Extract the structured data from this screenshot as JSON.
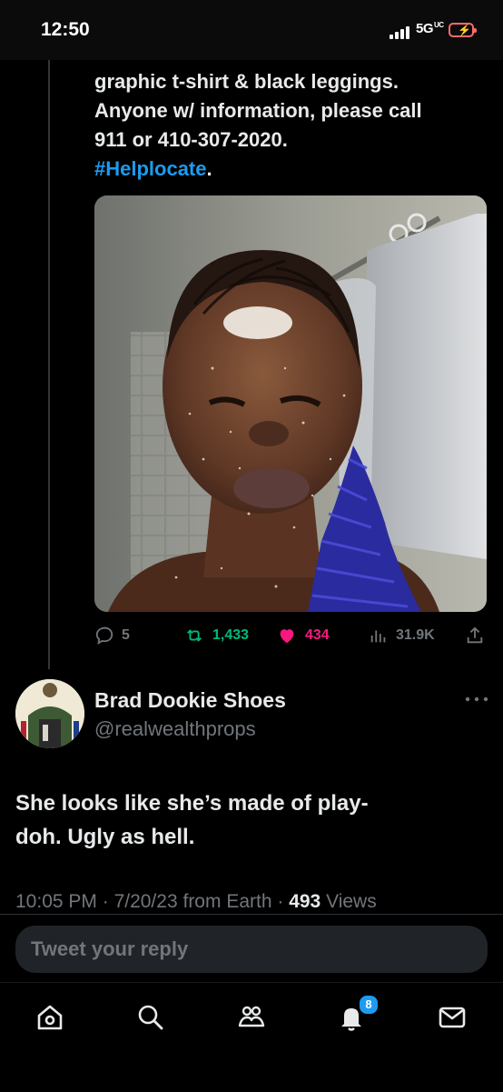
{
  "status_bar": {
    "time": "12:50",
    "network": "5G",
    "network_suffix": "UC"
  },
  "tweet": {
    "lines": [
      "graphic t-shirt & black leggings.",
      "Anyone w/ information, please call",
      "911 or 410-307-2020."
    ],
    "hashtag": "#Helplocate",
    "hashtag_trail": ".",
    "stats": {
      "replies": "5",
      "retweets": "1,433",
      "likes": "434",
      "views": "31.9K"
    }
  },
  "reply": {
    "display_name": "Brad Dookie Shoes",
    "handle": "@realwealthprops",
    "text_lines": [
      "She looks like she’s made of play-",
      "doh. Ugly as hell."
    ],
    "time": "10:05 PM",
    "date": "7/20/23",
    "source": "from Earth",
    "views_count": "493",
    "views_label": "Views"
  },
  "composer": {
    "placeholder": "Tweet your reply"
  },
  "nav": {
    "notifications_badge": "8"
  },
  "colors": {
    "accent": "#1d9bf0",
    "retweet": "#00ba7c",
    "like": "#f91880",
    "muted": "#71767b"
  }
}
